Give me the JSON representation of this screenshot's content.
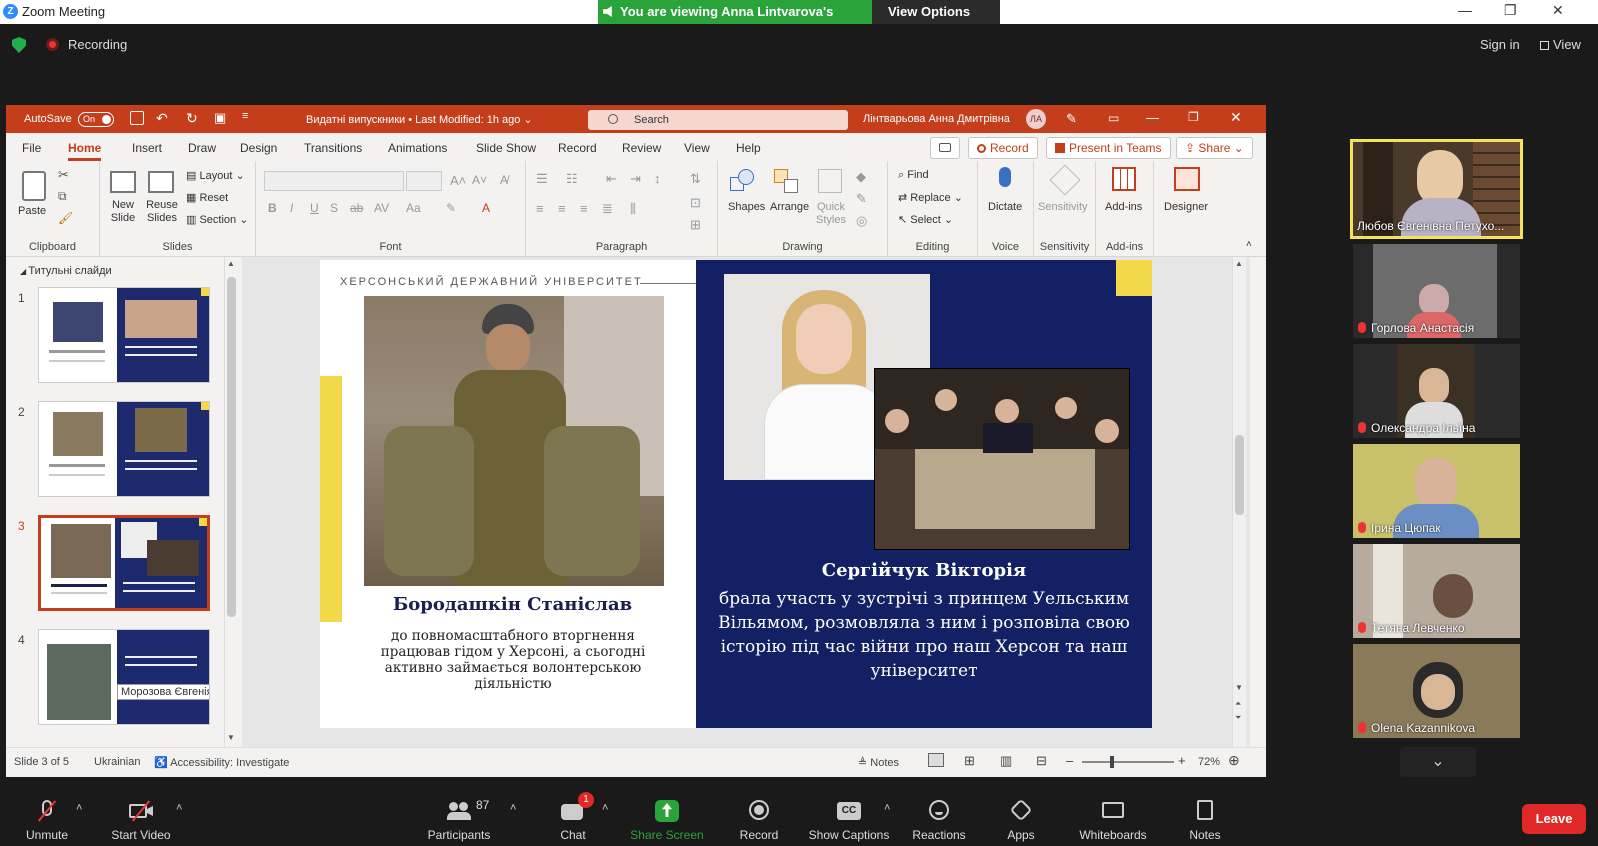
{
  "zoom": {
    "window_title": "Zoom Meeting",
    "banner_text": "You are viewing Anna Lintvarova's screen",
    "view_options": "View Options",
    "recording_label": "Recording",
    "sign_in": "Sign in",
    "view_label": "View"
  },
  "ppt": {
    "autosave_label": "AutoSave",
    "autosave_state": "On",
    "doc_title": "Видатні випускники • Last Modified: 1h ago",
    "search_placeholder": "Search",
    "user_name": "Лінтварьова Анна Дмитрівна",
    "user_initials": "ЛА",
    "tabs": [
      "File",
      "Home",
      "Insert",
      "Draw",
      "Design",
      "Transitions",
      "Animations",
      "Slide Show",
      "Record",
      "Review",
      "View",
      "Help"
    ],
    "active_tab": "Home",
    "record_btn": "Record",
    "present_btn": "Present in Teams",
    "share_btn": "Share",
    "ribbon": {
      "paste": "Paste",
      "clipboard": "Clipboard",
      "new_slide": "New Slide",
      "reuse_slides": "Reuse Slides",
      "layout": "Layout",
      "reset": "Reset",
      "section": "Section",
      "slides": "Slides",
      "font": "Font",
      "paragraph": "Paragraph",
      "shapes": "Shapes",
      "arrange": "Arrange",
      "quick_styles": "Quick Styles",
      "drawing": "Drawing",
      "find": "Find",
      "replace": "Replace",
      "select": "Select",
      "editing": "Editing",
      "dictate": "Dictate",
      "voice": "Voice",
      "sensitivity": "Sensitivity",
      "sensitivity_group": "Sensitivity",
      "addins": "Add-ins",
      "addins_group": "Add-ins",
      "designer": "Designer"
    },
    "section_title": "Титульні слайди",
    "thumbs": [
      {
        "num": "1",
        "note": ""
      },
      {
        "num": "2",
        "note": ""
      },
      {
        "num": "3",
        "note": ""
      },
      {
        "num": "4",
        "note": "Морозова Євгенія"
      }
    ],
    "slide": {
      "university": "ХЕРСОНСЬКИЙ ДЕРЖАВНИЙ УНІВЕРСИТЕТ",
      "left_name": "Бородашкін Станіслав",
      "left_desc": "до повномасштабного вторгнення працював гідом у Херсоні, а сьогодні активно займається волонтерською діяльністю",
      "right_name": "Сергійчук Вікторія",
      "right_desc": "брала участь у зустрічі з принцем Уельським Вільямом, розмовляла з ним і розповіла свою історію під час війни про наш Херсон та наш університет"
    },
    "status": {
      "slide_info": "Slide 3 of 5",
      "language": "Ukrainian",
      "accessibility": "Accessibility: Investigate",
      "notes": "Notes",
      "zoom": "72%"
    }
  },
  "participants": [
    {
      "name": "Любов Євгенівна Петухо...",
      "active": true
    },
    {
      "name": "Горлова Анастасія",
      "active": false
    },
    {
      "name": "Олександра Ільїна",
      "active": false
    },
    {
      "name": "Ірина Цюпак",
      "active": false
    },
    {
      "name": "Тетяна Левченко",
      "active": false
    },
    {
      "name": "Olena Kazannikova",
      "active": false
    }
  ],
  "toolbar": {
    "unmute": "Unmute",
    "start_video": "Start Video",
    "participants": "Participants",
    "participants_count": "87",
    "chat": "Chat",
    "chat_badge": "1",
    "share_screen": "Share Screen",
    "record": "Record",
    "show_captions": "Show Captions",
    "reactions": "Reactions",
    "apps": "Apps",
    "whiteboards": "Whiteboards",
    "notes": "Notes",
    "leave": "Leave"
  },
  "colors": {
    "ppt_accent": "#c43e1c",
    "zoom_green": "#29a33a",
    "slide_navy": "#132064",
    "slide_yellow": "#f3d84a",
    "leave_red": "#e02828"
  }
}
